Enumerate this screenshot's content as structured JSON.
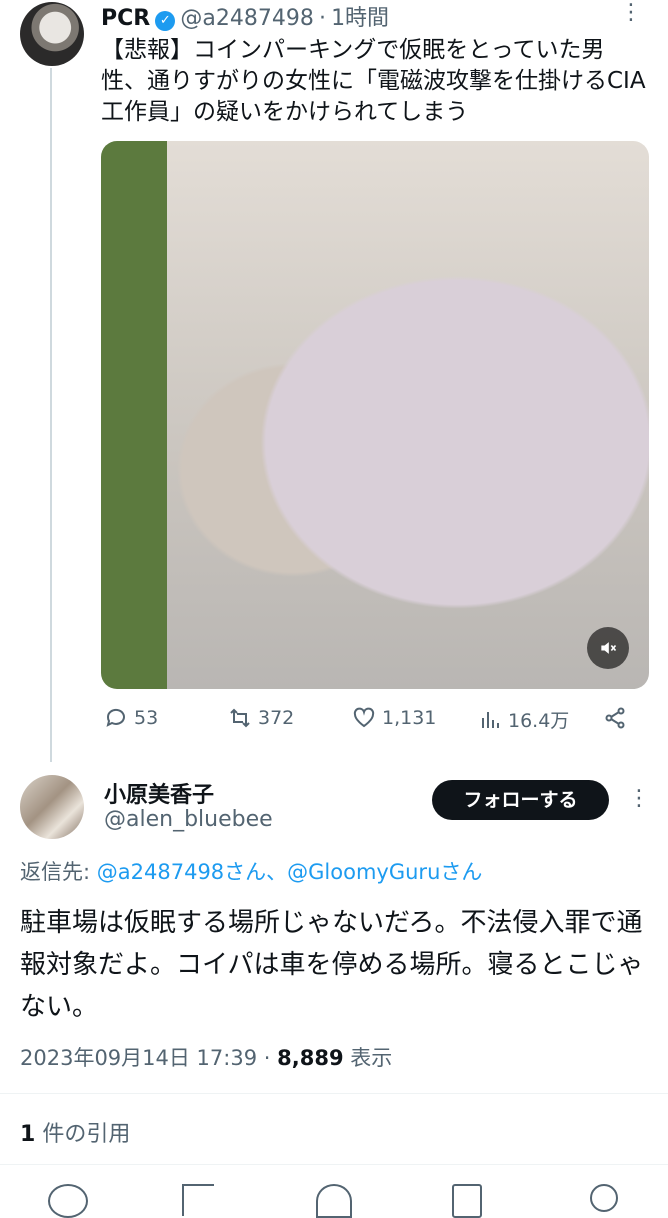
{
  "tweet1": {
    "display_name": "PCR",
    "handle": "@a2487498",
    "time": "1時間",
    "text": "【悲報】コインパーキングで仮眠をとっていた男性、通りすがりの女性に「電磁波攻撃を仕掛けるCIA工作員」の疑いをかけられてしまう",
    "replies": "53",
    "retweets": "372",
    "likes": "1,131",
    "views": "16.4万"
  },
  "tweet2": {
    "display_name": "小原美香子",
    "handle": "@alen_bluebee",
    "follow_label": "フォローする",
    "reply_prefix": "返信先:",
    "reply_to": "@a2487498さん、@GloomyGuruさん",
    "text": "駐車場は仮眠する場所じゃないだろ。不法侵入罪で通報対象だよ。コイパは車を停める場所。寝るとこじゃない。",
    "timestamp": "2023年09月14日 17:39",
    "views_count": "8,889",
    "views_label": "表示"
  },
  "quotes": {
    "count": "1",
    "label": "件の引用"
  },
  "colors": {
    "accent": "#1d9bf0",
    "muted": "#536471",
    "text": "#0f1419"
  },
  "icons": [
    "more-icon",
    "verified-icon",
    "mute-icon",
    "reply-icon",
    "retweet-icon",
    "like-icon",
    "views-icon",
    "share-icon"
  ]
}
